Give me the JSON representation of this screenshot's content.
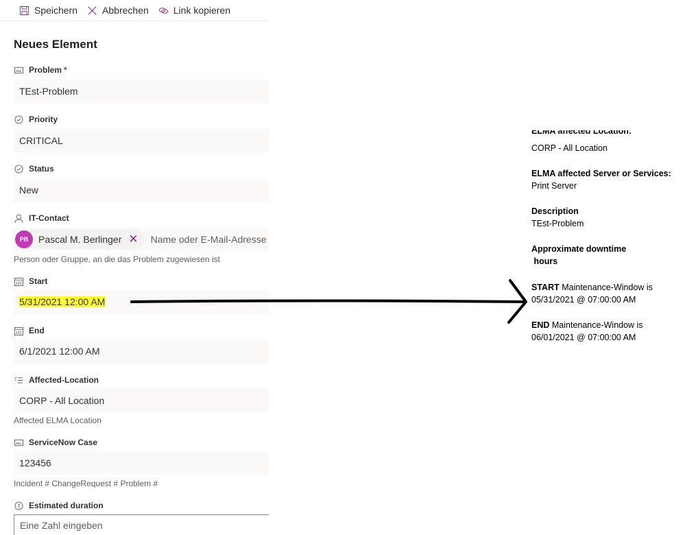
{
  "toolbar": {
    "save": "Speichern",
    "cancel": "Abbrechen",
    "copy_link": "Link kopieren"
  },
  "form": {
    "title": "Neues Element",
    "fields": [
      {
        "label": "Problem",
        "required": "*",
        "value": "TEst-Problem",
        "icon": "text-field-icon"
      },
      {
        "label": "Priority",
        "value": "CRITICAL",
        "icon": "choice-check-icon"
      },
      {
        "label": "Status",
        "value": "New",
        "icon": "choice-check-icon"
      },
      {
        "label": "IT-Contact",
        "icon": "person-icon",
        "persona": {
          "initials": "PB",
          "name": "Pascal M. Berlinger"
        },
        "placeholder": "Name oder E-Mail-Adresse eingeben",
        "help": "Person oder Gruppe, an die das Problem zugewiesen ist"
      },
      {
        "label": "Start",
        "value": "5/31/2021 12:00 AM",
        "icon": "calendar-icon",
        "highlight": "#ffff2e"
      },
      {
        "label": "End",
        "value": "6/1/2021 12:00 AM",
        "icon": "calendar-icon"
      },
      {
        "label": "Affected-Location",
        "value": "CORP - All Location",
        "icon": "list-icon",
        "help": "Affected ELMA Location"
      },
      {
        "label": "ServiceNow Case",
        "value": "123456",
        "icon": "text-field-icon",
        "help": "Incident # ChangeRequest # Problem #"
      },
      {
        "label": "Estimated duration",
        "placeholder": "Eine Zahl eingeben",
        "icon": "number-icon"
      }
    ]
  },
  "email": {
    "cut_label": "ELMA affected Location:",
    "location": "CORP - All Location",
    "servers_label": "ELMA affected Server or Services:",
    "servers": "Print Server",
    "description_label": "Description",
    "description": "TEst-Problem",
    "downtime_label": "Approximate downtime",
    "downtime_unit": " hours",
    "start_label": "START",
    "start_text": " Maintenance-Window is",
    "start_value": "05/31/2021 @ 07:00:00 AM",
    "end_label": "END",
    "end_text": " Maintenance-Window is",
    "end_value": "06/01/2021 @ 07:00:00 AM"
  },
  "colors": {
    "accent": "#8e2f87",
    "avatar": "#c239b3",
    "highlight": "#ffff2e",
    "field_bg": "#faf9f8"
  }
}
